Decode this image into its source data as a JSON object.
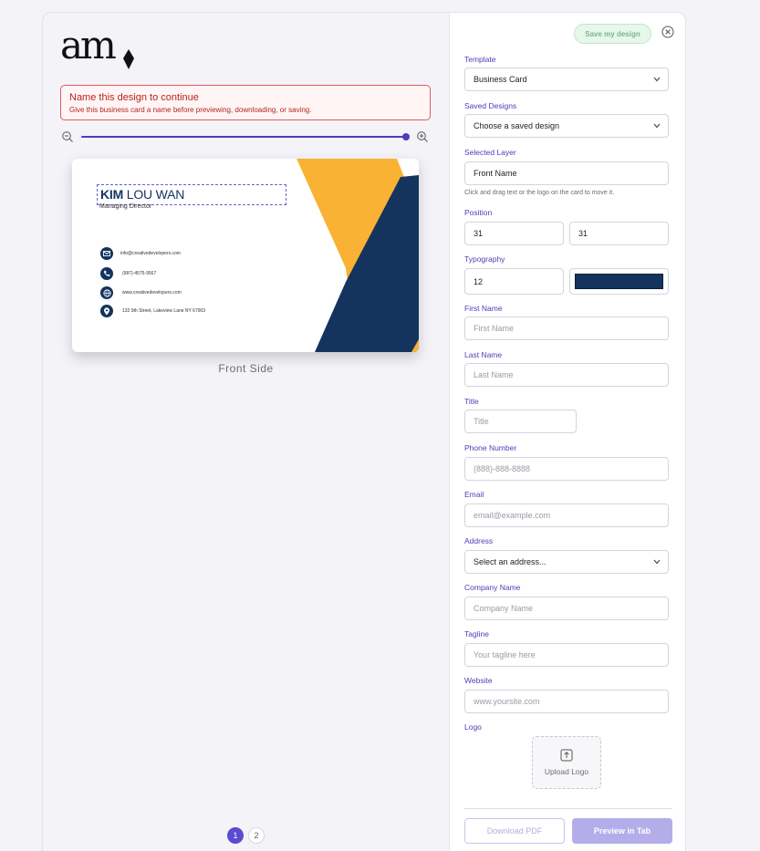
{
  "brand": {
    "logo_text": "am"
  },
  "alert": {
    "title": "Name this design to continue",
    "message": "Give this business card a name before previewing, downloading, or saving."
  },
  "zoom": {
    "level_fraction": 1.0
  },
  "card": {
    "first_name": "KIM",
    "last_name": "LOU WAN",
    "title": "Managing Director",
    "email": "info@creativedevelopers.com",
    "phone": "(987)-4575-9567",
    "website": "www.creativedevelopers.com",
    "address": "132 9th Street, Lakeview Lane NY 67903",
    "colors": {
      "navy": "#14345e",
      "yellow": "#f9b233"
    },
    "side_label": "Front Side"
  },
  "pagination": {
    "pages": [
      "1",
      "2"
    ],
    "current": "1"
  },
  "panel": {
    "save_label": "Save my design",
    "template": {
      "label": "Template",
      "value": "Business Card"
    },
    "saved_designs": {
      "label": "Saved Designs",
      "value": "Choose a saved design"
    },
    "selected_layer": {
      "label": "Selected Layer",
      "value": "Front Name",
      "hint": "Click and drag text or the logo on the card to move it."
    },
    "position": {
      "label": "Position",
      "x": "31",
      "y": "31"
    },
    "typography": {
      "label": "Typography",
      "size": "12",
      "color": "#14345e"
    },
    "first_name": {
      "label": "First Name",
      "placeholder": "First Name"
    },
    "last_name": {
      "label": "Last Name",
      "placeholder": "Last Name"
    },
    "title": {
      "label": "Title",
      "placeholder": "Title"
    },
    "phone": {
      "label": "Phone Number",
      "placeholder": "(888)-888-8888"
    },
    "email": {
      "label": "Email",
      "placeholder": "email@example.com"
    },
    "address": {
      "label": "Address",
      "value": "Select an address..."
    },
    "company": {
      "label": "Company Name",
      "placeholder": "Company Name"
    },
    "tagline": {
      "label": "Tagline",
      "placeholder": "Your tagline here"
    },
    "website": {
      "label": "Website",
      "placeholder": "www.yoursite.com"
    },
    "logo": {
      "label": "Logo",
      "upload_label": "Upload Logo"
    },
    "download_label": "Download PDF",
    "preview_label": "Preview in Tab"
  }
}
